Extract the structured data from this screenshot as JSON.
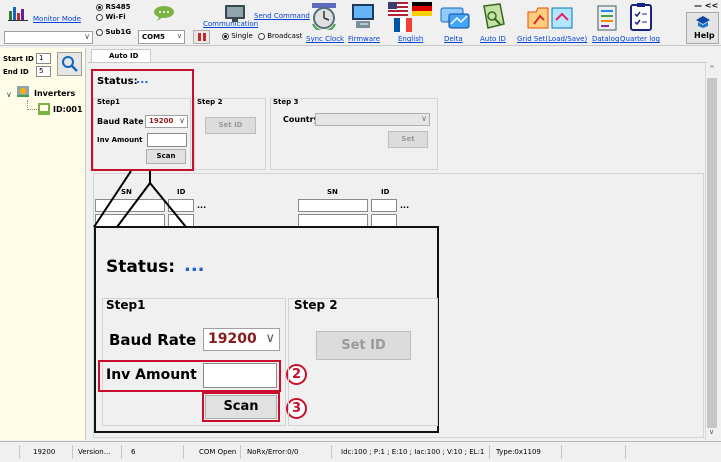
{
  "toolbar": {
    "monitor_mode": "Monitor Mode",
    "conn_rs485": "RS485",
    "conn_wifi": "Wi-Fi",
    "conn_sub1g": "Sub1G",
    "communication": "Communication",
    "com_port": "COM5",
    "send_command": "Send Command",
    "single": "Single",
    "broadcast": "Broadcast",
    "sync_clock": "Sync Clock",
    "firmware": "Firmware",
    "english": "English",
    "delta": "Delta",
    "auto_id": "Auto ID",
    "grid_set": "Grid Set(Load/Save)",
    "datalog": "Datalog",
    "quarter_log": "Quarter log",
    "help": "Help",
    "window_controls": "— <<"
  },
  "sidebar": {
    "start_id_label": "Start ID",
    "start_id_value": "1",
    "end_id_label": "End ID",
    "end_id_value": "5",
    "tree_root": "Inverters",
    "tree_child": "ID:001"
  },
  "tab": {
    "label": "Auto ID"
  },
  "panel": {
    "status_label": "Status:",
    "status_value": "...",
    "step1": "Step1",
    "step2": "Step 2",
    "step3": "Step 3",
    "baud_rate_label": "Baud Rate",
    "baud_rate_value": "19200",
    "inv_amount_label": "Inv Amount",
    "inv_amount_value": "",
    "scan": "Scan",
    "set_id": "Set ID",
    "country_label": "Country",
    "country_value": "",
    "set": "Set",
    "sn_header": "SN",
    "id_header": "ID",
    "ellipsis": "..."
  },
  "zoom": {
    "status_label": "Status:",
    "status_value": "...",
    "step1": "Step1",
    "step2": "Step 2",
    "baud_rate_label": "Baud Rate",
    "baud_rate_value": "19200",
    "inv_amount_label": "Inv Amount",
    "inv_amount_value": "",
    "scan": "Scan",
    "set_id": "Set ID",
    "callout_2": "2",
    "callout_3": "3"
  },
  "statusbar": {
    "baud": "19200",
    "version": "Version...",
    "count": "6",
    "com": "COM Open",
    "norx": "NoRx/Error:0/0",
    "idc": "Idc:100 ; P:1 ; E:10 ; Iac:100 ; V:10 ; EL:1",
    "type": "Type:0x1109"
  },
  "colors": {
    "highlight": "#c8102e",
    "status_dots": "#1f5fd1",
    "baud_text": "#8b1a1a"
  }
}
